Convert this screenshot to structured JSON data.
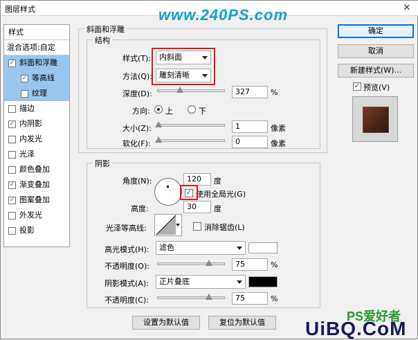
{
  "window": {
    "title": "图层样式",
    "close_glyph": "✕"
  },
  "watermark": "www.240PS.com",
  "left_panel": {
    "header": "样式",
    "blend": "混合选项:自定",
    "items": [
      {
        "label": "斜面和浮雕",
        "checked": true,
        "selected": true,
        "sub": false
      },
      {
        "label": "等高线",
        "checked": true,
        "selected": true,
        "sub": true
      },
      {
        "label": "纹理",
        "checked": false,
        "selected": true,
        "sub": true
      },
      {
        "label": "描边",
        "checked": false,
        "selected": false,
        "sub": false
      },
      {
        "label": "内阴影",
        "checked": true,
        "selected": false,
        "sub": false
      },
      {
        "label": "内发光",
        "checked": false,
        "selected": false,
        "sub": false
      },
      {
        "label": "光泽",
        "checked": false,
        "selected": false,
        "sub": false
      },
      {
        "label": "颜色叠加",
        "checked": false,
        "selected": false,
        "sub": false
      },
      {
        "label": "渐变叠加",
        "checked": true,
        "selected": false,
        "sub": false
      },
      {
        "label": "图案叠加",
        "checked": true,
        "selected": false,
        "sub": false
      },
      {
        "label": "外发光",
        "checked": false,
        "selected": false,
        "sub": false
      },
      {
        "label": "投影",
        "checked": false,
        "selected": false,
        "sub": false
      }
    ]
  },
  "bevel": {
    "group_title": "斜面和浮雕",
    "structure_title": "结构",
    "style_label": "样式(T):",
    "style_value": "内斜面",
    "technique_label": "方法(Q):",
    "technique_value": "雕刻清晰",
    "depth_label": "深度(D):",
    "depth_value": "327",
    "depth_unit": "%",
    "depth_level": 0.33,
    "direction_label": "方向:",
    "dir_up": "上",
    "dir_down": "下",
    "size_label": "大小(Z):",
    "size_value": "1",
    "size_unit": "像素",
    "soften_label": "软化(F):",
    "soften_value": "0",
    "soften_unit": "像素"
  },
  "shading": {
    "title": "阴影",
    "angle_label": "角度(N):",
    "angle_value": "120",
    "angle_unit": "度",
    "global_light_label": "使用全局光(G)",
    "altitude_label": "高度:",
    "altitude_value": "30",
    "altitude_unit": "度",
    "gloss_label": "光泽等高线:",
    "antialias_label": "消除锯齿(L)",
    "highlight_mode_label": "高光模式(H):",
    "highlight_mode_value": "滤色",
    "highlight_color": "#ffffff",
    "highlight_opacity_label": "不透明度(O):",
    "highlight_opacity_value": "75",
    "highlight_opacity_level": 0.75,
    "shadow_mode_label": "阴影模式(A):",
    "shadow_mode_value": "正片叠底",
    "shadow_color": "#000000",
    "shadow_opacity_label": "不透明度(C):",
    "shadow_opacity_value": "75",
    "shadow_opacity_level": 0.75,
    "percent": "%"
  },
  "bottom": {
    "set_default": "设置为默认值",
    "reset_default": "复位为默认值"
  },
  "right": {
    "ok": "确定",
    "cancel": "取消",
    "new_style": "新建样式(W)...",
    "preview": "预览(V)"
  },
  "logo": {
    "main": "UiBQ.CoM",
    "top": "PS爱好者"
  }
}
